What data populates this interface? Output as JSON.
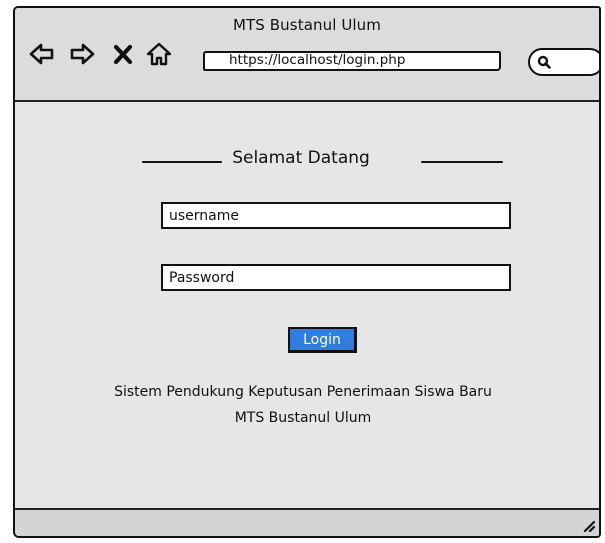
{
  "window": {
    "title": "MTS Bustanul Ulum"
  },
  "nav": {
    "back_icon": "arrow-left-icon",
    "forward_icon": "arrow-right-icon",
    "close_icon": "x-icon",
    "home_icon": "home-icon"
  },
  "address_bar": {
    "url": "https://localhost/login.php"
  },
  "search": {
    "icon": "search-icon"
  },
  "login": {
    "heading": "Selamat Datang",
    "username_placeholder": "username",
    "password_placeholder": "Password",
    "button_label": "Login"
  },
  "footer": {
    "line1": "Sistem Pendukung Keputusan Penerimaan Siswa Baru",
    "line2": "MTS Bustanul Ulum"
  },
  "colors": {
    "window_bg": "#e6e6e6",
    "button_bg": "#2f7de1",
    "border": "#111111"
  }
}
